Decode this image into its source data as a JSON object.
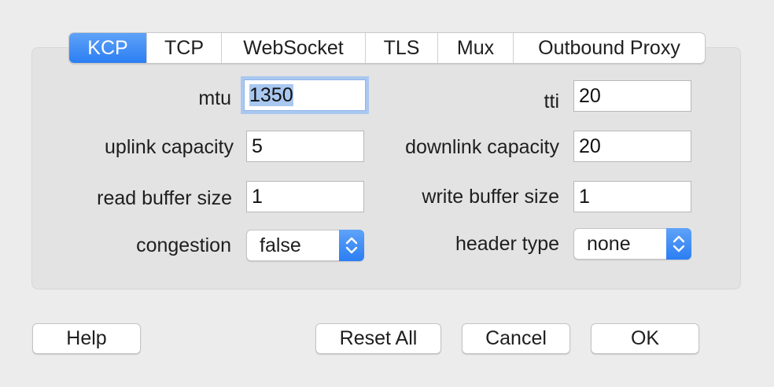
{
  "tabs": [
    {
      "label": "KCP",
      "selected": true
    },
    {
      "label": "TCP",
      "selected": false
    },
    {
      "label": "WebSocket",
      "selected": false
    },
    {
      "label": "TLS",
      "selected": false
    },
    {
      "label": "Mux",
      "selected": false
    },
    {
      "label": "Outbound Proxy",
      "selected": false
    }
  ],
  "form": {
    "mtu": {
      "label": "mtu",
      "value": "1350"
    },
    "tti": {
      "label": "tti",
      "value": "20"
    },
    "uplink_capacity": {
      "label": "uplink capacity",
      "value": "5"
    },
    "downlink_capacity": {
      "label": "downlink capacity",
      "value": "20"
    },
    "read_buffer_size": {
      "label": "read buffer size",
      "value": "1"
    },
    "write_buffer_size": {
      "label": "write buffer size",
      "value": "1"
    },
    "congestion": {
      "label": "congestion",
      "value": "false"
    },
    "header_type": {
      "label": "header type",
      "value": "none"
    }
  },
  "buttons": {
    "help": "Help",
    "reset_all": "Reset All",
    "cancel": "Cancel",
    "ok": "OK"
  },
  "colors": {
    "accent": "#2b7ef3",
    "focus_ring": "#a9c8f0",
    "window_bg": "#ececec"
  },
  "icons": {
    "popup_stepper": "chevron-up-down-icon"
  }
}
